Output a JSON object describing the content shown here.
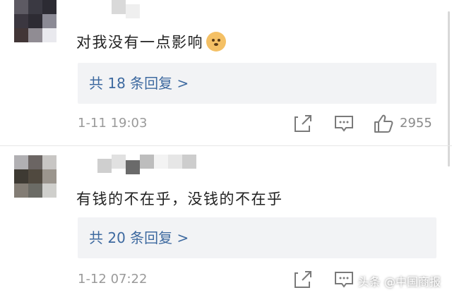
{
  "comments": [
    {
      "text": "对我没有一点影响",
      "emoji": "doge-emoji",
      "replies_label": "共 18 条回复 >",
      "time": "1-11 19:03",
      "likes": "2955",
      "avatar_colors": [
        "#5d5a63",
        "#3a3942",
        "#2c2b33",
        "#3b3740",
        "#2d2b33",
        "#8b8a95",
        "#423637",
        "#908c93",
        "#e9e9ee"
      ],
      "username_colors": [
        "#d9d9d9",
        "#efefef"
      ]
    },
    {
      "text": "有钱的不在乎，没钱的不在乎",
      "replies_label": "共 20 条回复 >",
      "time": "1-12 07:22",
      "likes": "",
      "avatar_colors": [
        "#b1b0b3",
        "#6b6563",
        "#c8c6c4",
        "#3e3a33",
        "#50493f",
        "#9b958d",
        "#837d75",
        "#6b6b65",
        "#cfcfcc"
      ],
      "username_colors": [
        "#cfcfcf",
        "#e1e1e1",
        "#6a6a6a",
        "#bdbdbd",
        "#f3f3f3",
        "#e6e6e6",
        "#cdcdcd"
      ]
    }
  ],
  "icons": {
    "share": "share-icon",
    "reply": "comment-icon",
    "like": "thumbs-up-icon"
  },
  "watermark": "头条 @中国商报"
}
